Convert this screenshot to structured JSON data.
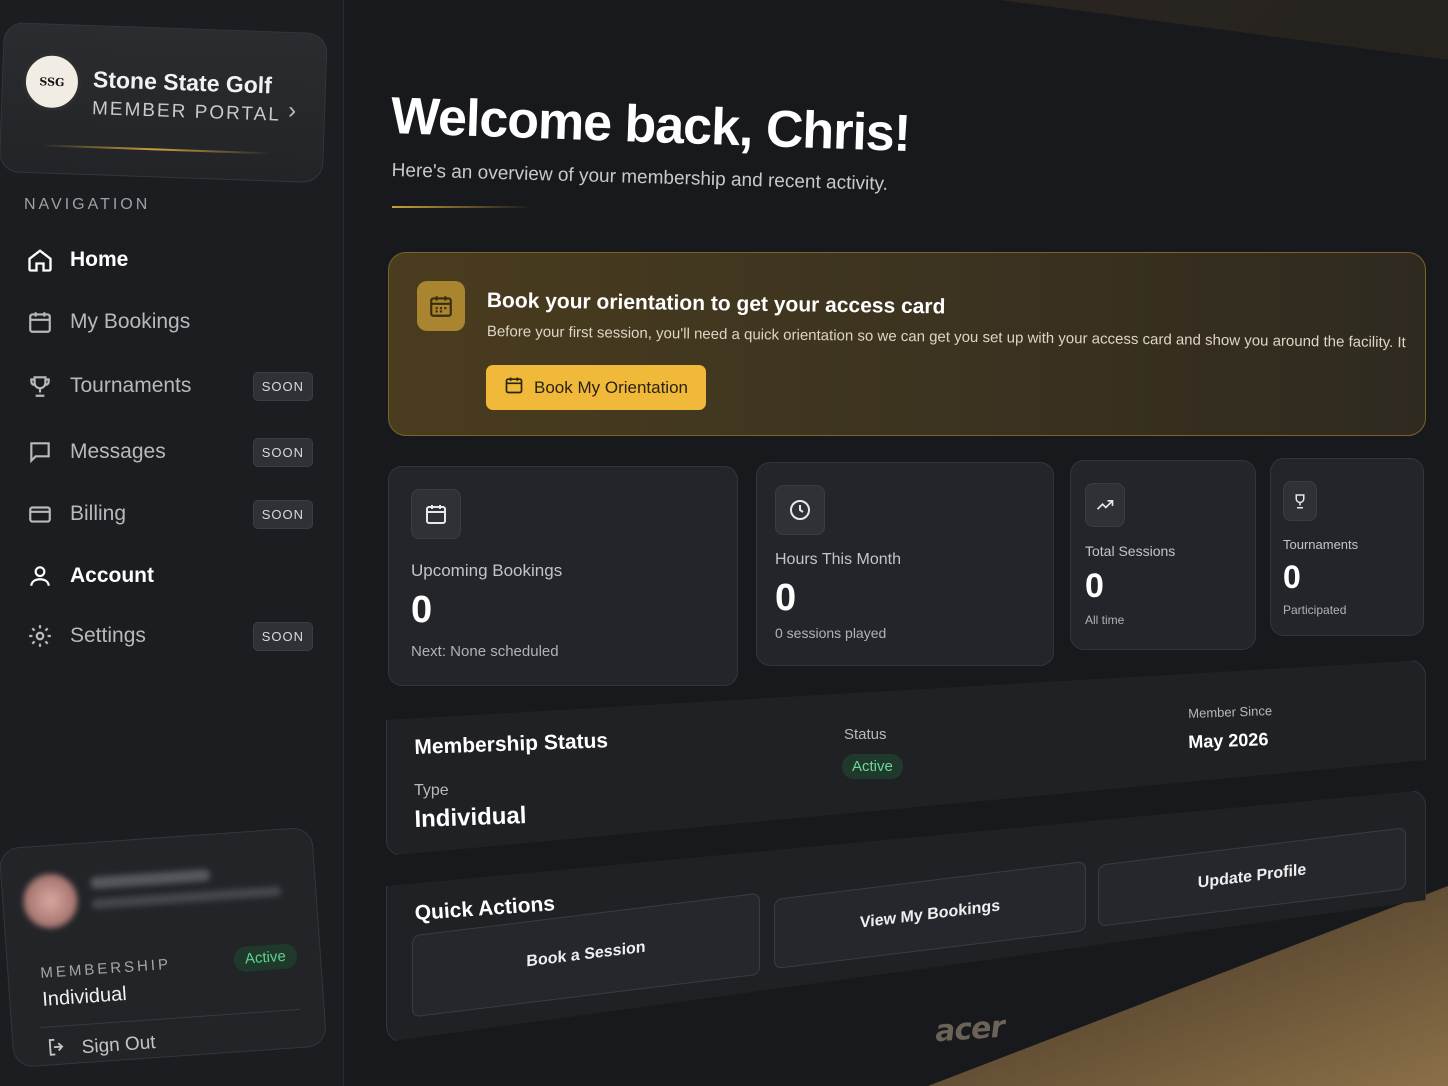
{
  "brand": {
    "logo_text": "SSG",
    "name": "Stone State Golf",
    "subtitle": "MEMBER PORTAL"
  },
  "nav": {
    "heading": "NAVIGATION",
    "items": [
      {
        "label": "Home",
        "icon": "home-icon",
        "active": true,
        "badge": ""
      },
      {
        "label": "My Bookings",
        "icon": "calendar-icon",
        "active": false,
        "badge": ""
      },
      {
        "label": "Tournaments",
        "icon": "trophy-icon",
        "active": false,
        "badge": "SOON"
      },
      {
        "label": "Messages",
        "icon": "message-icon",
        "active": false,
        "badge": "SOON"
      },
      {
        "label": "Billing",
        "icon": "credit-card-icon",
        "active": false,
        "badge": "SOON"
      },
      {
        "label": "Account",
        "icon": "user-icon",
        "active": false,
        "badge": ""
      },
      {
        "label": "Settings",
        "icon": "gear-icon",
        "active": false,
        "badge": "SOON"
      }
    ]
  },
  "user_card": {
    "membership_label": "MEMBERSHIP",
    "membership_value": "Individual",
    "status": "Active",
    "sign_out": "Sign Out"
  },
  "header": {
    "welcome": "Welcome back, Chris!",
    "subtitle": "Here's an overview of your membership and recent activity."
  },
  "orientation": {
    "title": "Book your orientation to get your access card",
    "text": "Before your first session, you'll need a quick orientation so we can get you set up with your access card and show you around the facility. It only takes",
    "button": "Book My Orientation"
  },
  "stats": [
    {
      "label": "Upcoming Bookings",
      "value": "0",
      "sub": "Next: None scheduled",
      "icon": "calendar-icon"
    },
    {
      "label": "Hours This Month",
      "value": "0",
      "sub": "0 sessions played",
      "icon": "clock-icon"
    },
    {
      "label": "Total Sessions",
      "value": "0",
      "sub": "All time",
      "icon": "trending-up-icon"
    },
    {
      "label": "Tournaments",
      "value": "0",
      "sub": "Participated",
      "icon": "trophy-icon"
    }
  ],
  "membership": {
    "title": "Membership Status",
    "type_label": "Type",
    "type_value": "Individual",
    "status_label": "Status",
    "status_value": "Active",
    "since_label": "Member Since",
    "since_value": "May 2026"
  },
  "quick_actions": {
    "title": "Quick Actions",
    "buttons": [
      "Book a Session",
      "View My Bookings",
      "Update Profile"
    ]
  },
  "monitor_brand": "acer",
  "colors": {
    "accent_gold": "#f1b93a",
    "status_green": "#5fd08e",
    "background": "#17191d"
  }
}
